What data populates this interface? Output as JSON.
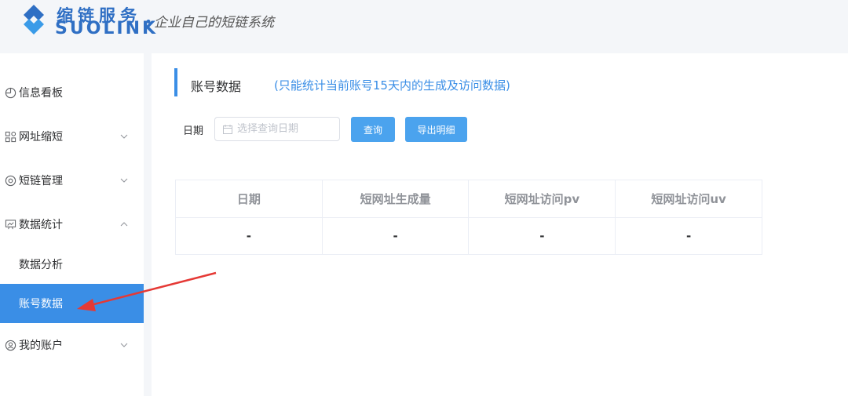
{
  "header": {
    "brand_cn": "缩链服务",
    "brand_en": "SUOLINK",
    "slogan_dot": "•",
    "slogan": "企业自己的短链系统",
    "brand_color": "#2f6fc4"
  },
  "sidebar": {
    "items": [
      {
        "label": "信息看板",
        "icon": "clock-icon"
      },
      {
        "label": "网址缩短",
        "icon": "grid-icon"
      },
      {
        "label": "短链管理",
        "icon": "settings-icon"
      },
      {
        "label": "数据统计",
        "icon": "chart-icon"
      },
      {
        "label": "数据分析"
      },
      {
        "label": "账号数据",
        "active": true
      },
      {
        "label": "我的账户",
        "icon": "user-icon"
      }
    ],
    "active_color": "#3a8ee6"
  },
  "main": {
    "title": "账号数据",
    "note": "(只能统计当前账号15天内的生成及访问数据)",
    "filter": {
      "date_label": "日期",
      "date_placeholder": "选择查询日期",
      "query_button": "查询",
      "export_button": "导出明细"
    },
    "table": {
      "headers": [
        "日期",
        "短网址生成量",
        "短网址访问pv",
        "短网址访问uv"
      ],
      "rows": [
        [
          "-",
          "-",
          "-",
          "-"
        ]
      ]
    }
  },
  "annotation": {
    "arrow_color": "#e53935"
  }
}
